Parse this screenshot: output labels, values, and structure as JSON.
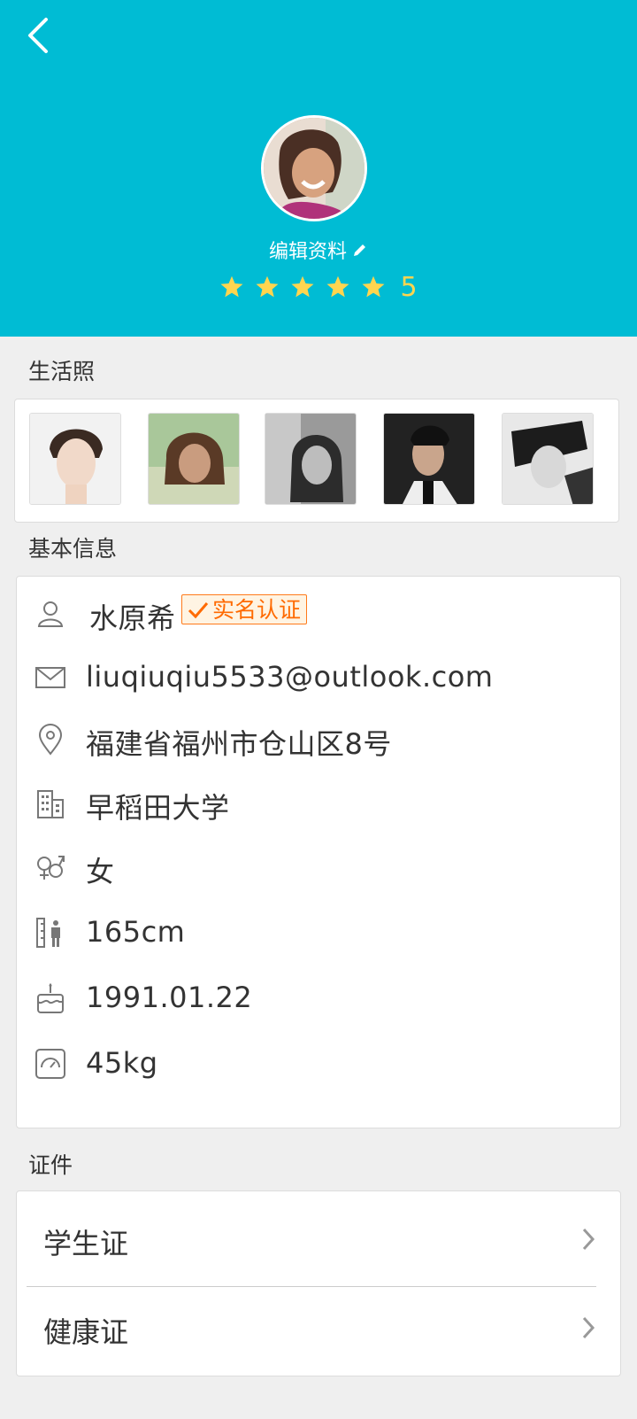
{
  "header": {
    "edit_label": "编辑资料",
    "rating_value": "5",
    "rating_stars": 5,
    "accent": "#00bcd4",
    "star_color": "#ffd54f"
  },
  "sections": {
    "photos_title": "生活照",
    "basic_title": "基本信息",
    "docs_title": "证件"
  },
  "basic_info": {
    "name": "水原希",
    "verified_label": "实名认证",
    "email": "liuqiuqiu5533@outlook.com",
    "address": "福建省福州市仓山区8号",
    "school": "早稻田大学",
    "gender": "女",
    "height": "165cm",
    "birthday": "1991.01.22",
    "weight": "45kg"
  },
  "documents": [
    {
      "label": "学生证"
    },
    {
      "label": "健康证"
    }
  ]
}
